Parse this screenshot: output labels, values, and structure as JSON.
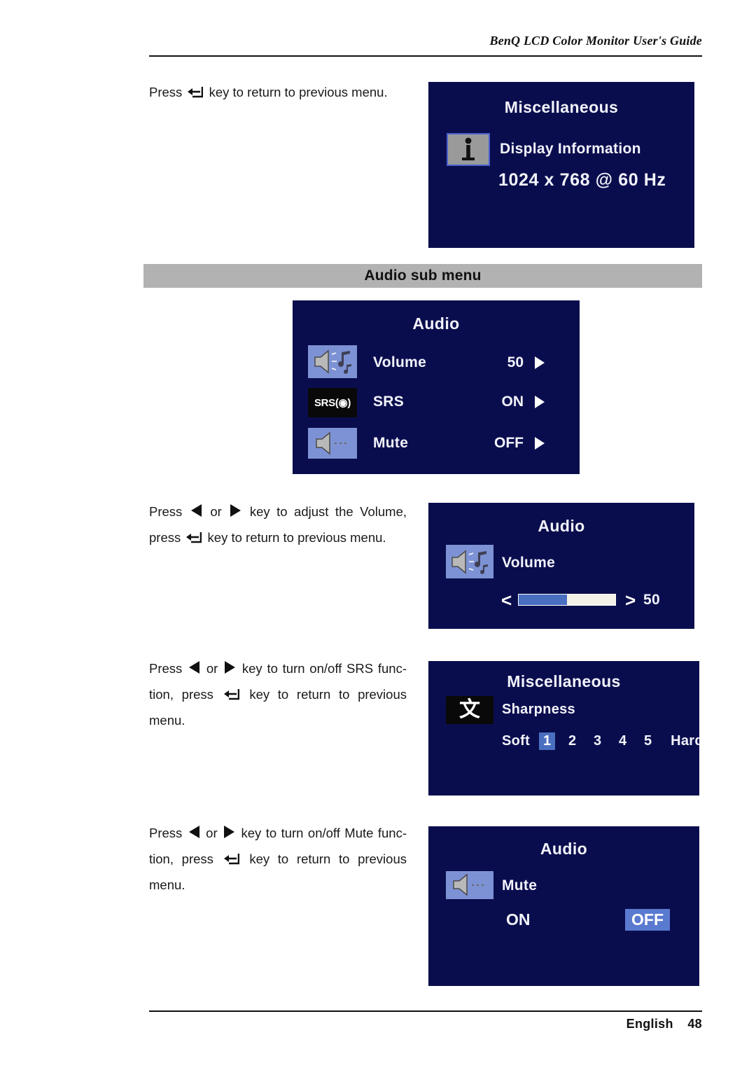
{
  "header": {
    "title": "BenQ LCD Color Monitor User's Guide"
  },
  "footer": {
    "language": "English",
    "page": "48"
  },
  "section": {
    "banner": "Audio sub menu"
  },
  "paragraphs": {
    "p1": {
      "before": "Press",
      "icon": "return-key-icon",
      "after": "key to return to previous menu."
    },
    "p2": {
      "l1_a": "Press",
      "l1_b": "or",
      "l1_c": "key to adjust the Volume,",
      "l2_a": "press",
      "l2_b": "key to return to previous menu."
    },
    "p3": {
      "l1_a": "Press",
      "l1_b": "or",
      "l1_c": "key to turn on/off SRS func-",
      "l2_a": "tion, press",
      "l2_b": "key to return to previous",
      "l3": "menu."
    },
    "p4": {
      "l1_a": "Press",
      "l1_b": "or",
      "l1_c": "key to turn on/off Mute func-",
      "l2_a": "tion, press",
      "l2_b": "key to return to previous",
      "l3": "menu."
    }
  },
  "osd_misc_info": {
    "title": "Miscellaneous",
    "icon": "information-icon",
    "label": "Display Information",
    "resolution": "1024 x 768 @ 60 Hz"
  },
  "osd_audio_menu": {
    "title": "Audio",
    "rows": [
      {
        "icon": "speaker-music-icon",
        "label": "Volume",
        "value": "50",
        "arrow": "right-arrow-icon"
      },
      {
        "icon": "srs-logo-icon",
        "label": "SRS",
        "value": "ON",
        "arrow": "right-arrow-icon"
      },
      {
        "icon": "speaker-mute-icon",
        "label": "Mute",
        "value": "OFF",
        "arrow": "right-arrow-icon"
      }
    ]
  },
  "osd_volume": {
    "title": "Audio",
    "icon": "speaker-music-icon",
    "label": "Volume",
    "left_chevron": "<",
    "right_chevron": ">",
    "value": "50",
    "fill_percent": 50
  },
  "osd_sharpness": {
    "title": "Miscellaneous",
    "icon": "chinese-character-icon",
    "icon_glyph": "文",
    "label": "Sharpness",
    "soft_label": "Soft",
    "hard_label": "Hard",
    "levels": [
      "1",
      "2",
      "3",
      "4",
      "5"
    ],
    "selected": "1"
  },
  "osd_mute": {
    "title": "Audio",
    "icon": "speaker-mute-icon",
    "label": "Mute",
    "on_label": "ON",
    "off_label": "OFF",
    "selected": "OFF"
  },
  "colors": {
    "osd_background": "#0a0d4d",
    "osd_text": "#f2f3fb",
    "highlight": "#4a6fc0",
    "tile_blue": "#7d92d4",
    "banner_gray": "#b2b2b2"
  }
}
